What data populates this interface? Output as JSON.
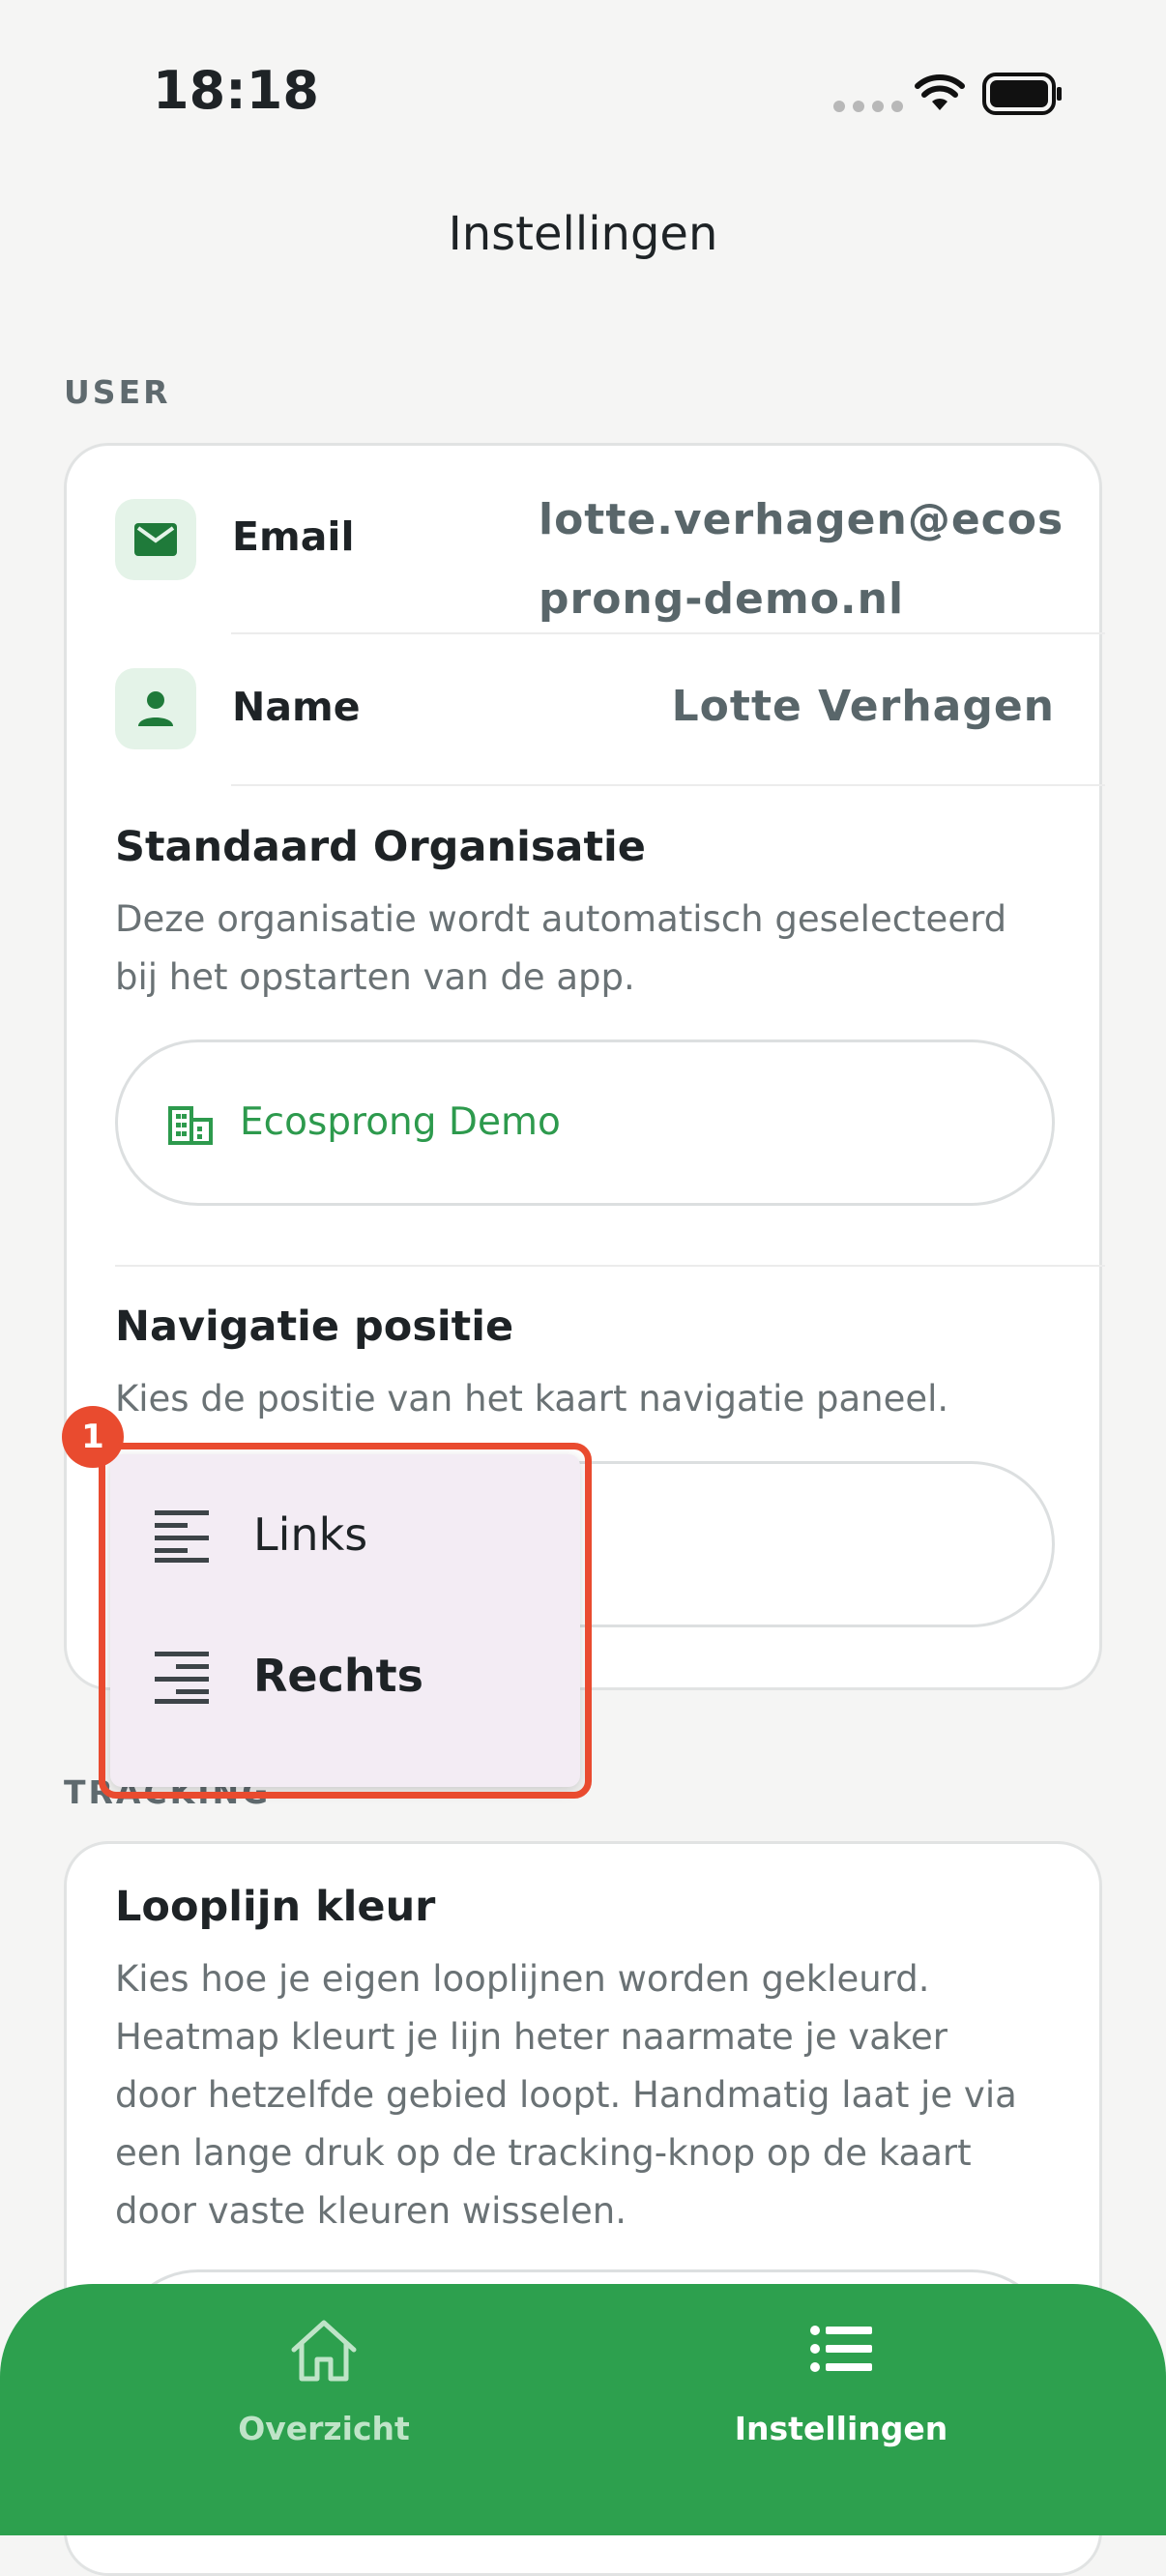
{
  "status_bar": {
    "time": "18:18"
  },
  "header": {
    "title": "Instellingen"
  },
  "user_section": {
    "label": "USER",
    "email_label": "Email",
    "email_value_line1": "lotte.verhagen@ecos",
    "email_value_line2": "prong-demo.nl",
    "name_label": "Name",
    "name_value": "Lotte Verhagen",
    "org_title": "Standaard Organisatie",
    "org_desc_line1": "Deze organisatie wordt automatisch geselecteerd",
    "org_desc_line2": "bij het opstarten van de app.",
    "org_value": "Ecosprong Demo",
    "nav_title": "Navigatie positie",
    "nav_desc": "Kies de positie van het kaart navigatie paneel."
  },
  "dropdown": {
    "badge": "1",
    "options": [
      {
        "label": "Links",
        "icon": "align-left-icon",
        "selected": false
      },
      {
        "label": "Rechts",
        "icon": "align-right-icon",
        "selected": true
      }
    ]
  },
  "tracking_section": {
    "label": "TRACKING",
    "title": "Looplijn kleur",
    "desc_lines": [
      "Kies hoe je eigen looplijnen worden gekleurd.",
      "Heatmap kleurt je lijn heter naarmate je vaker",
      "door hetzelfde gebied loopt. Handmatig laat je via",
      "een lange druk op de tracking-knop op de kaart",
      "door vaste kleuren wisselen."
    ]
  },
  "tab_bar": {
    "tabs": [
      {
        "label": "Overzicht",
        "icon": "home-icon",
        "active": false
      },
      {
        "label": "Instellingen",
        "icon": "list-icon",
        "active": true
      }
    ]
  },
  "colors": {
    "accent": "#2da04e",
    "highlight": "#e94b2f",
    "popup_bg": "#f3ecf4"
  }
}
